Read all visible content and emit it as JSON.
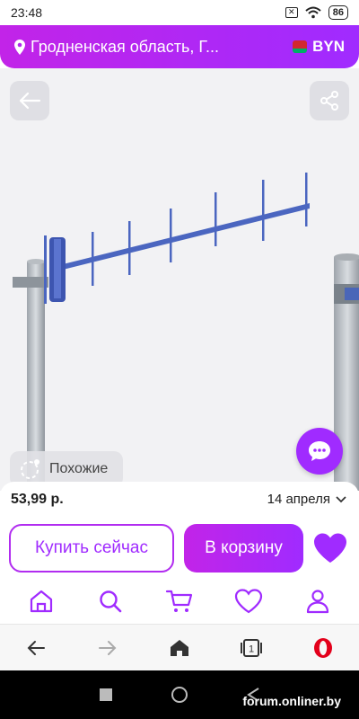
{
  "status_bar": {
    "time": "23:48",
    "battery": "86",
    "x_badge": "✕"
  },
  "header": {
    "region": "Гродненская область, Г...",
    "currency": "BYN",
    "colors": {
      "gradient_start": "#c224e8",
      "gradient_end": "#a02bff"
    }
  },
  "hero": {
    "similar_label": "Похожие",
    "icons": {
      "back": "arrow-left-icon",
      "share": "share-icon",
      "chat": "chat-bubble-icon",
      "similar": "similar-search-icon"
    }
  },
  "product": {
    "price": "53,99 р.",
    "delivery_date": "14 апреля"
  },
  "actions": {
    "buy_now": "Купить сейчас",
    "to_cart": "В корзину"
  },
  "tabbar": {
    "items": [
      {
        "name": "home",
        "icon": "home-icon"
      },
      {
        "name": "search",
        "icon": "search-icon"
      },
      {
        "name": "cart",
        "icon": "cart-icon"
      },
      {
        "name": "favorites",
        "icon": "heart-icon"
      },
      {
        "name": "profile",
        "icon": "user-icon"
      }
    ]
  },
  "browser_bar": {
    "tab_count": "1",
    "icons": [
      "back-arrow-icon",
      "forward-arrow-icon",
      "home-icon",
      "tabs-icon",
      "opera-icon"
    ]
  },
  "watermark": "forum.onliner.by"
}
